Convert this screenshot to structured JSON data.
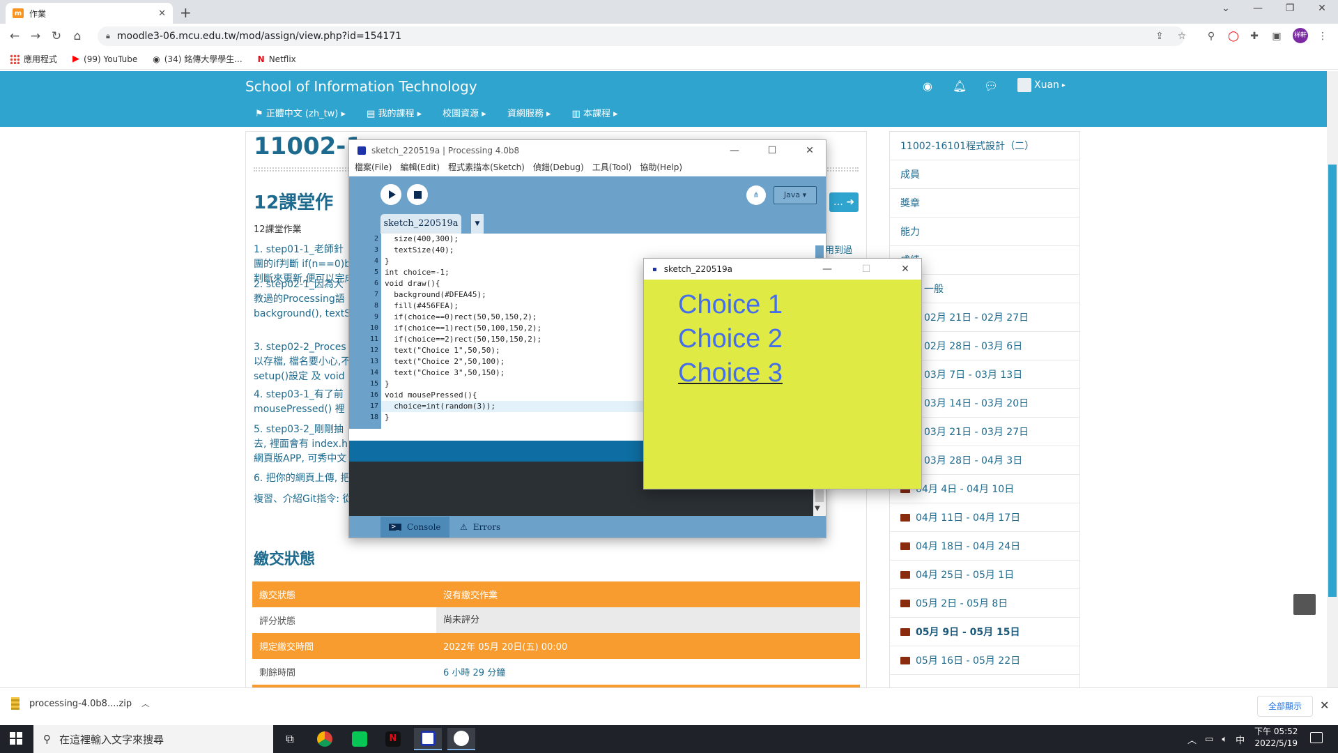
{
  "browser": {
    "tab_title": "作業",
    "url": "moodle3-06.mcu.edu.tw/mod/assign/view.php?id=154171",
    "bookmarks": [
      "應用程式",
      "(99) YouTube",
      "(34) 銘傳大學學生...",
      "Netflix"
    ],
    "profile_initials": "祥軒"
  },
  "moodle": {
    "site_name": "School of Information Technology",
    "menu": [
      "正體中文 (zh_tw)",
      "我的課程",
      "校園資源",
      "資網服務",
      "本課程"
    ],
    "user_name": "Xuan",
    "course_title": "11002-1",
    "course_title_right": "程式設計（二）",
    "assignment_title": "12課堂作",
    "assignment_subtitle": "12課堂作業",
    "paragraphs": [
      {
        "lines": [
          "1. step01-1_老師針",
          "團的if判斷 if(n==0)b",
          "判斷來更新,便可以完成"
        ]
      },
      {
        "lines": [
          "2. step02-1_因為大",
          "教過的Processing語",
          "background(), textS"
        ]
      },
      {
        "lines": [
          "3. step02-2_Proces",
          "以存檔, 檔名要小心,不",
          "setup()設定 及 void"
        ]
      },
      {
        "lines": [
          "4. step03-1_有了前",
          "mousePressed() 裡"
        ]
      },
      {
        "lines": [
          "5. step03-2_剛剛抽",
          "去, 裡面會有 index.h",
          "網頁版APP, 可秀中文"
        ]
      },
      {
        "lines": [
          "6. 把你的網頁上傳, 把"
        ]
      },
      {
        "lines": [
          "複習、介紹Git指令: 從"
        ]
      }
    ],
    "right_clip_text": "用到過",
    "submit_button": "…",
    "status_heading": "繳交狀態",
    "status_rows": [
      {
        "key": "繳交狀態",
        "value": "沒有繳交作業"
      },
      {
        "key": "評分狀態",
        "value": "尚未評分"
      },
      {
        "key": "規定繳交時間",
        "value": "2022年 05月 20日(五) 00:00"
      },
      {
        "key": "剩餘時間",
        "value": "6 小時 29 分鐘"
      }
    ],
    "sidebar": [
      "11002-16101程式設計（二）",
      "成員",
      "獎章",
      "能力",
      "成績",
      "一般",
      "02月 21日 - 02月 27日",
      "02月 28日 - 03月 6日",
      "03月 7日 - 03月 13日",
      "03月 14日 - 03月 20日",
      "03月 21日 - 03月 27日",
      "03月 28日 - 04月 3日",
      "04月 4日 - 04月 10日",
      "04月 11日 - 04月 17日",
      "04月 18日 - 04月 24日",
      "04月 25日 - 05月 1日",
      "05月 2日 - 05月 8日",
      "05月 9日 - 05月 15日",
      "05月 16日 - 05月 22日"
    ]
  },
  "processing": {
    "window_title": "sketch_220519a | Processing 4.0b8",
    "menu": [
      "檔案(File)",
      "編輯(Edit)",
      "程式素描本(Sketch)",
      "偵錯(Debug)",
      "工具(Tool)",
      "協助(Help)"
    ],
    "mode": "Java ▾",
    "tab": "sketch_220519a",
    "code": [
      {
        "n": "2",
        "t": "  size(400,300);"
      },
      {
        "n": "3",
        "t": "  textSize(40);"
      },
      {
        "n": "4",
        "t": "}"
      },
      {
        "n": "5",
        "t": "int choice=-1;"
      },
      {
        "n": "6",
        "t": "void draw(){"
      },
      {
        "n": "7",
        "t": "  background(#DFEA45);"
      },
      {
        "n": "8",
        "t": "  fill(#456FEA);"
      },
      {
        "n": "9",
        "t": "  if(choice==0)rect(50,50,150,2);"
      },
      {
        "n": "10",
        "t": "  if(choice==1)rect(50,100,150,2);"
      },
      {
        "n": "11",
        "t": "  if(choice==2)rect(50,150,150,2);"
      },
      {
        "n": "12",
        "t": "  text(\"Choice 1\",50,50);"
      },
      {
        "n": "13",
        "t": "  text(\"Choice 2\",50,100);"
      },
      {
        "n": "14",
        "t": "  text(\"Choice 3\",50,150);"
      },
      {
        "n": "15",
        "t": "}"
      },
      {
        "n": "16",
        "t": "void mousePressed(){"
      },
      {
        "n": "17",
        "t": "  choice=int(random(3));"
      },
      {
        "n": "18",
        "t": "}"
      }
    ],
    "footer_tabs": [
      "Console",
      "Errors"
    ]
  },
  "sketch": {
    "title": "sketch_220519a",
    "choices": [
      "Choice 1",
      "Choice 2",
      "Choice 3"
    ],
    "selected_choice": 3,
    "bg_color": "#DFEA45",
    "fill_color": "#456FEA"
  },
  "download": {
    "file": "processing-4.0b8....zip",
    "show_all": "全部顯示"
  },
  "taskbar": {
    "search_placeholder": "在這裡輸入文字來搜尋",
    "ime": "中",
    "time": "下午 05:52",
    "date": "2022/5/19"
  }
}
